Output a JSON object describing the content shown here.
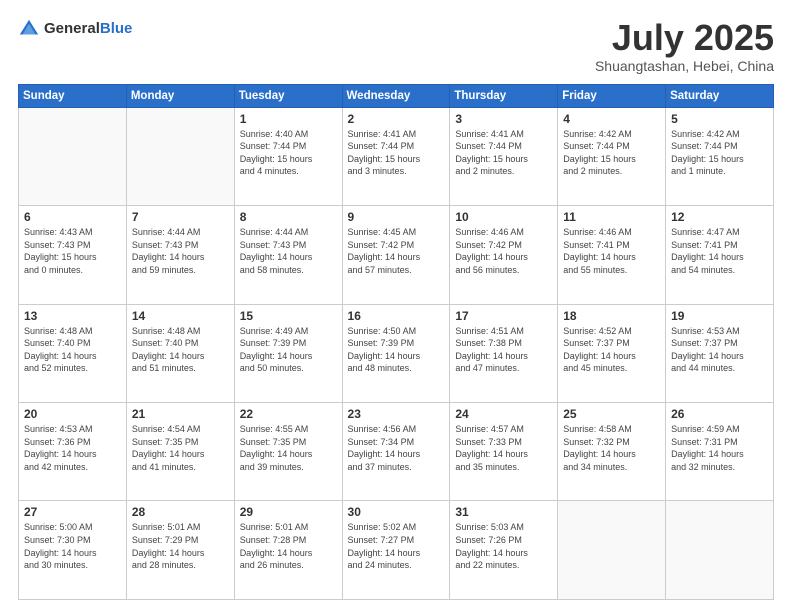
{
  "header": {
    "logo_general": "General",
    "logo_blue": "Blue",
    "title": "July 2025",
    "location": "Shuangtashan, Hebei, China"
  },
  "weekdays": [
    "Sunday",
    "Monday",
    "Tuesday",
    "Wednesday",
    "Thursday",
    "Friday",
    "Saturday"
  ],
  "weeks": [
    [
      {
        "day": "",
        "detail": ""
      },
      {
        "day": "",
        "detail": ""
      },
      {
        "day": "1",
        "detail": "Sunrise: 4:40 AM\nSunset: 7:44 PM\nDaylight: 15 hours\nand 4 minutes."
      },
      {
        "day": "2",
        "detail": "Sunrise: 4:41 AM\nSunset: 7:44 PM\nDaylight: 15 hours\nand 3 minutes."
      },
      {
        "day": "3",
        "detail": "Sunrise: 4:41 AM\nSunset: 7:44 PM\nDaylight: 15 hours\nand 2 minutes."
      },
      {
        "day": "4",
        "detail": "Sunrise: 4:42 AM\nSunset: 7:44 PM\nDaylight: 15 hours\nand 2 minutes."
      },
      {
        "day": "5",
        "detail": "Sunrise: 4:42 AM\nSunset: 7:44 PM\nDaylight: 15 hours\nand 1 minute."
      }
    ],
    [
      {
        "day": "6",
        "detail": "Sunrise: 4:43 AM\nSunset: 7:43 PM\nDaylight: 15 hours\nand 0 minutes."
      },
      {
        "day": "7",
        "detail": "Sunrise: 4:44 AM\nSunset: 7:43 PM\nDaylight: 14 hours\nand 59 minutes."
      },
      {
        "day": "8",
        "detail": "Sunrise: 4:44 AM\nSunset: 7:43 PM\nDaylight: 14 hours\nand 58 minutes."
      },
      {
        "day": "9",
        "detail": "Sunrise: 4:45 AM\nSunset: 7:42 PM\nDaylight: 14 hours\nand 57 minutes."
      },
      {
        "day": "10",
        "detail": "Sunrise: 4:46 AM\nSunset: 7:42 PM\nDaylight: 14 hours\nand 56 minutes."
      },
      {
        "day": "11",
        "detail": "Sunrise: 4:46 AM\nSunset: 7:41 PM\nDaylight: 14 hours\nand 55 minutes."
      },
      {
        "day": "12",
        "detail": "Sunrise: 4:47 AM\nSunset: 7:41 PM\nDaylight: 14 hours\nand 54 minutes."
      }
    ],
    [
      {
        "day": "13",
        "detail": "Sunrise: 4:48 AM\nSunset: 7:40 PM\nDaylight: 14 hours\nand 52 minutes."
      },
      {
        "day": "14",
        "detail": "Sunrise: 4:48 AM\nSunset: 7:40 PM\nDaylight: 14 hours\nand 51 minutes."
      },
      {
        "day": "15",
        "detail": "Sunrise: 4:49 AM\nSunset: 7:39 PM\nDaylight: 14 hours\nand 50 minutes."
      },
      {
        "day": "16",
        "detail": "Sunrise: 4:50 AM\nSunset: 7:39 PM\nDaylight: 14 hours\nand 48 minutes."
      },
      {
        "day": "17",
        "detail": "Sunrise: 4:51 AM\nSunset: 7:38 PM\nDaylight: 14 hours\nand 47 minutes."
      },
      {
        "day": "18",
        "detail": "Sunrise: 4:52 AM\nSunset: 7:37 PM\nDaylight: 14 hours\nand 45 minutes."
      },
      {
        "day": "19",
        "detail": "Sunrise: 4:53 AM\nSunset: 7:37 PM\nDaylight: 14 hours\nand 44 minutes."
      }
    ],
    [
      {
        "day": "20",
        "detail": "Sunrise: 4:53 AM\nSunset: 7:36 PM\nDaylight: 14 hours\nand 42 minutes."
      },
      {
        "day": "21",
        "detail": "Sunrise: 4:54 AM\nSunset: 7:35 PM\nDaylight: 14 hours\nand 41 minutes."
      },
      {
        "day": "22",
        "detail": "Sunrise: 4:55 AM\nSunset: 7:35 PM\nDaylight: 14 hours\nand 39 minutes."
      },
      {
        "day": "23",
        "detail": "Sunrise: 4:56 AM\nSunset: 7:34 PM\nDaylight: 14 hours\nand 37 minutes."
      },
      {
        "day": "24",
        "detail": "Sunrise: 4:57 AM\nSunset: 7:33 PM\nDaylight: 14 hours\nand 35 minutes."
      },
      {
        "day": "25",
        "detail": "Sunrise: 4:58 AM\nSunset: 7:32 PM\nDaylight: 14 hours\nand 34 minutes."
      },
      {
        "day": "26",
        "detail": "Sunrise: 4:59 AM\nSunset: 7:31 PM\nDaylight: 14 hours\nand 32 minutes."
      }
    ],
    [
      {
        "day": "27",
        "detail": "Sunrise: 5:00 AM\nSunset: 7:30 PM\nDaylight: 14 hours\nand 30 minutes."
      },
      {
        "day": "28",
        "detail": "Sunrise: 5:01 AM\nSunset: 7:29 PM\nDaylight: 14 hours\nand 28 minutes."
      },
      {
        "day": "29",
        "detail": "Sunrise: 5:01 AM\nSunset: 7:28 PM\nDaylight: 14 hours\nand 26 minutes."
      },
      {
        "day": "30",
        "detail": "Sunrise: 5:02 AM\nSunset: 7:27 PM\nDaylight: 14 hours\nand 24 minutes."
      },
      {
        "day": "31",
        "detail": "Sunrise: 5:03 AM\nSunset: 7:26 PM\nDaylight: 14 hours\nand 22 minutes."
      },
      {
        "day": "",
        "detail": ""
      },
      {
        "day": "",
        "detail": ""
      }
    ]
  ]
}
